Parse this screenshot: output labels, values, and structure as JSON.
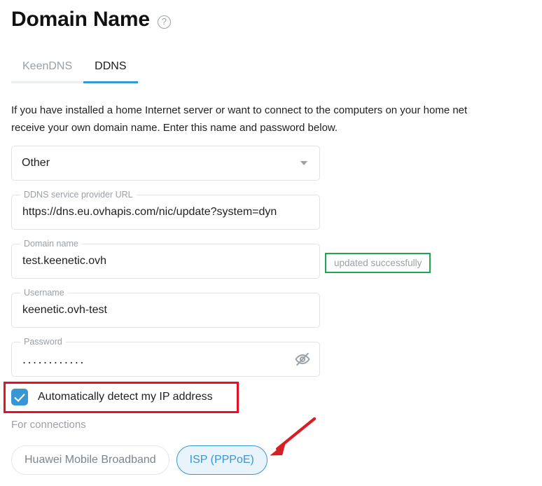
{
  "header": {
    "title": "Domain Name",
    "help_icon": "question-circle-icon"
  },
  "tabs": [
    {
      "label": "KeenDNS",
      "active": false
    },
    {
      "label": "DDNS",
      "active": true
    }
  ],
  "description": "If you have installed a home Internet server or want to connect to the computers on your home net\nreceive your own domain name. Enter this name and password below.",
  "form": {
    "provider_select": {
      "value": "Other",
      "caret_icon": "chevron-down-icon"
    },
    "url_field": {
      "legend": "DDNS service provider URL",
      "value": "https://dns.eu.ovhapis.com/nic/update?system=dyn"
    },
    "domain_field": {
      "legend": "Domain name",
      "value": "test.keenetic.ovh"
    },
    "username_field": {
      "legend": "Username",
      "value": "keenetic.ovh-test"
    },
    "password_field": {
      "legend": "Password",
      "value": "............",
      "toggle_icon": "eye-off-icon"
    },
    "status_badge": {
      "text": "updated successfully",
      "border_color": "#22a550"
    },
    "auto_detect_checkbox": {
      "label": "Automatically detect my IP address",
      "checked": true
    }
  },
  "connections": {
    "label": "For connections",
    "chips": [
      {
        "label": "Huawei Mobile Broadband",
        "selected": false
      },
      {
        "label": "ISP (PPPoE)",
        "selected": true
      }
    ]
  },
  "annotations": {
    "rect_color": "#e81123",
    "arrow_color": "#d81e24"
  },
  "colors": {
    "accent": "#3996d4",
    "success": "#22a550",
    "annotation": "#e81123",
    "muted_text": "#9aa0a6"
  }
}
